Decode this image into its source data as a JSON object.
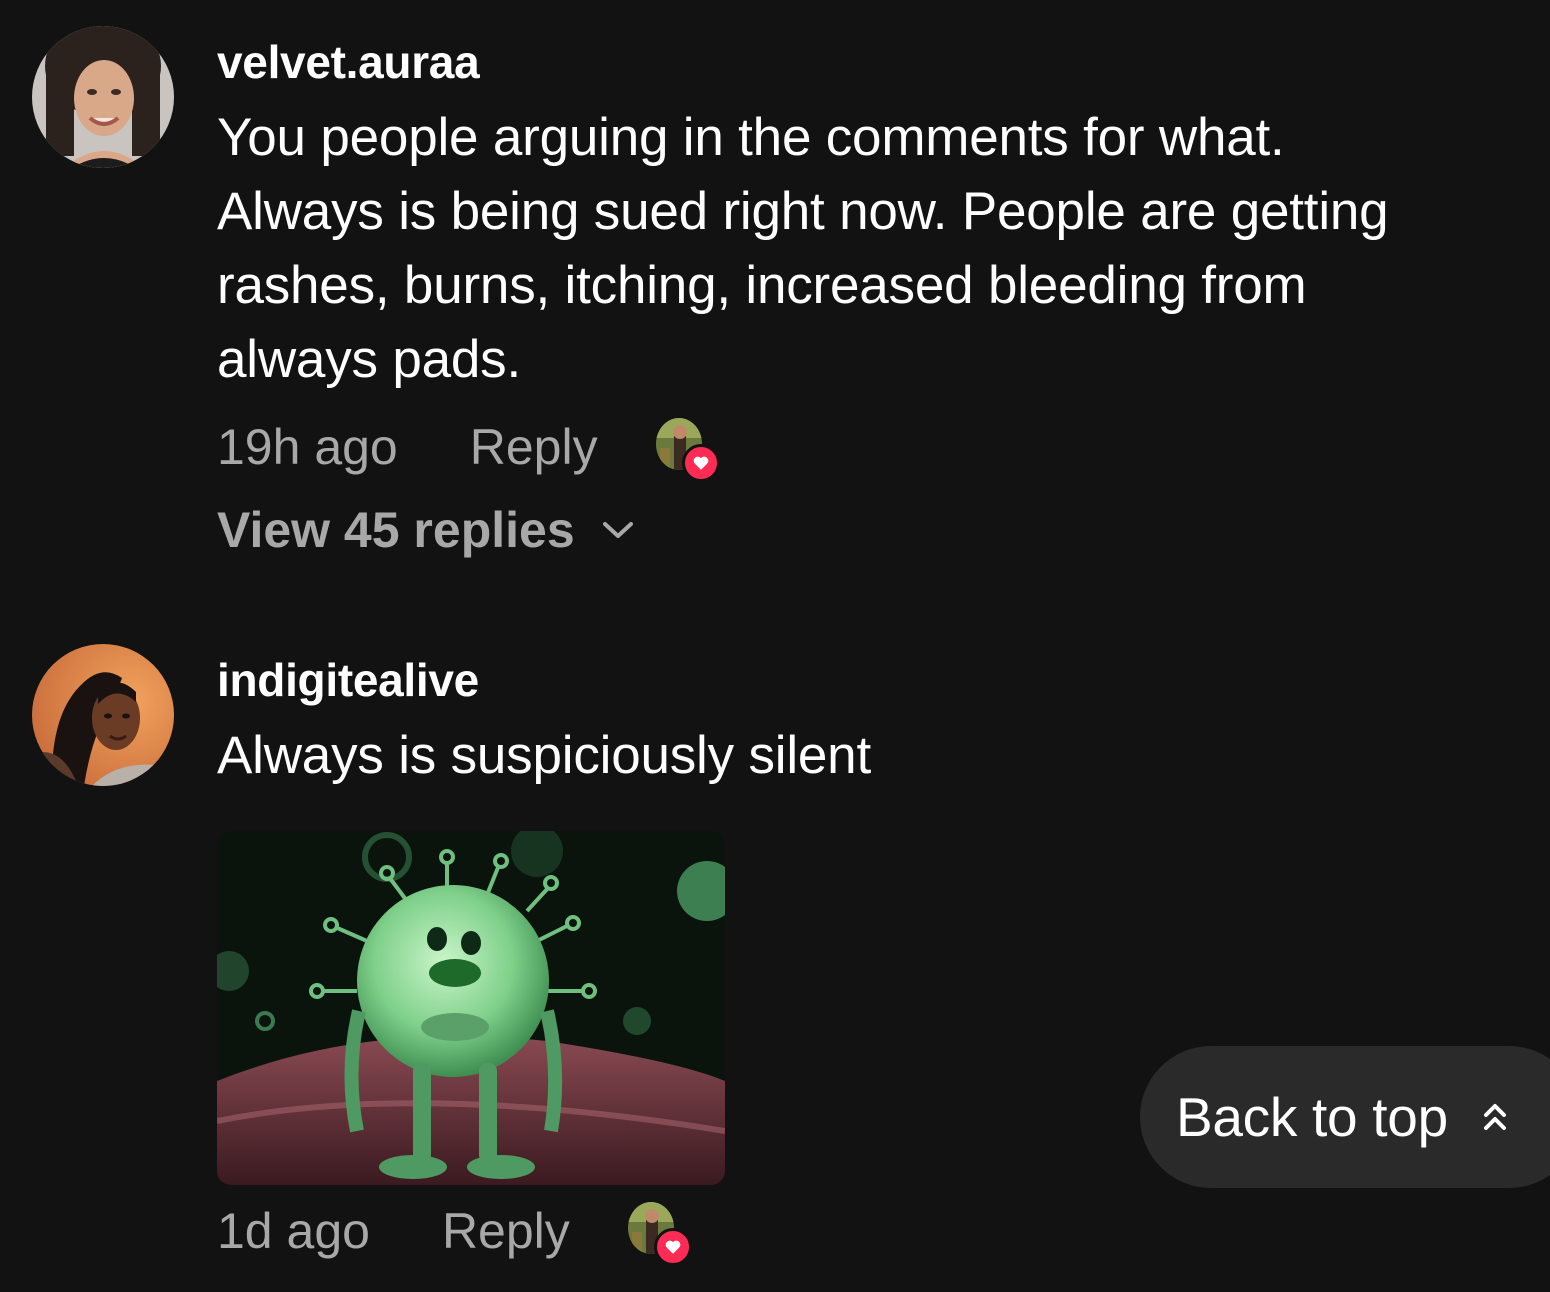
{
  "comments": [
    {
      "username": "velvet.auraa",
      "text": "You people arguing in the comments for what.\nAlways is being sued right now. People are getting\nrashes, burns, itching, increased bleeding from\nalways pads.",
      "time": "19h ago",
      "reply_label": "Reply",
      "view_replies_label": "View 45 replies",
      "avatar_icon": "user-avatar-photo",
      "creator_liked": true
    },
    {
      "username": "indigitealive",
      "text": "Always is suspiciously silent",
      "time": "1d ago",
      "reply_label": "Reply",
      "avatar_icon": "user-avatar-photo",
      "creator_liked": true,
      "attachment": "green-virus-gif"
    }
  ],
  "back_to_top": {
    "label": "Back to top",
    "icon": "double-chevron-up-icon"
  },
  "colors": {
    "background": "#121212",
    "text_primary": "#ffffff",
    "text_secondary": "#a8a8a8",
    "like_heart": "#fe2c55",
    "button_bg": "#2a2a2a"
  }
}
